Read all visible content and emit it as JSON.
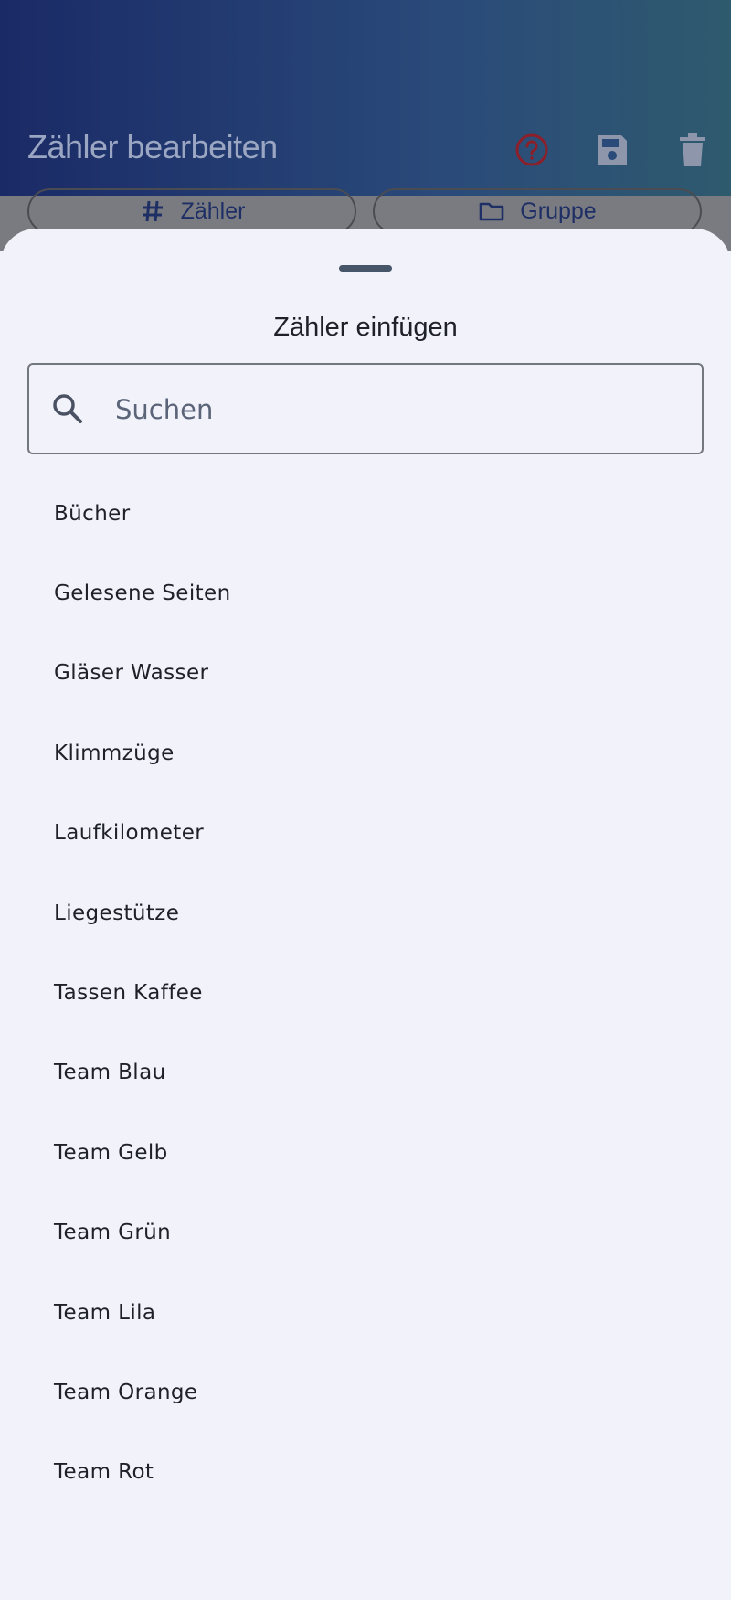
{
  "appbar": {
    "title": "Zähler bearbeiten",
    "icons": [
      "help-icon",
      "save-icon",
      "delete-icon"
    ]
  },
  "segments": {
    "counter_label": "Zähler",
    "group_label": "Gruppe"
  },
  "sheet": {
    "title": "Zähler einfügen",
    "search": {
      "placeholder": "Suchen",
      "value": ""
    },
    "items": [
      "Bücher",
      "Gelesene Seiten",
      "Gläser Wasser",
      "Klimmzüge",
      "Laufkilometer",
      "Liegestütze",
      "Tassen Kaffee",
      "Team Blau",
      "Team Gelb",
      "Team Grün",
      "Team Lila",
      "Team Orange",
      "Team Rot"
    ]
  },
  "colors": {
    "appbar_start": "#1a2a66",
    "appbar_end": "#2e5a6e",
    "sheet_bg": "#f2f3fa",
    "help_icon": "#8b1a1a",
    "text_primary": "#1f2129"
  }
}
